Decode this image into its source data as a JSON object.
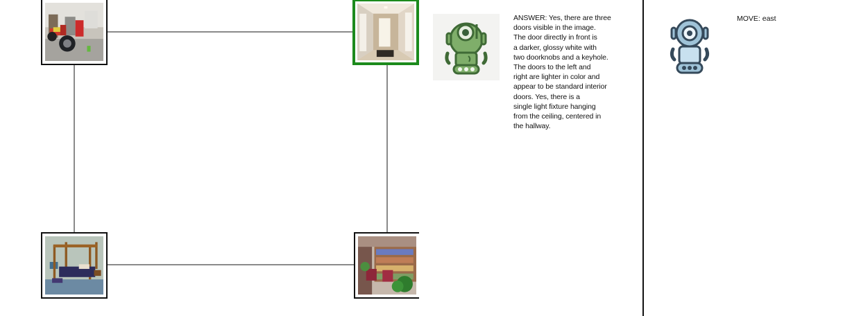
{
  "answer": {
    "text": "ANSWER: Yes, there are three\ndoors visible in the image.\nThe door directly in front is\na darker, glossy white with\ntwo doorknobs and a keyhole.\nThe doors to the left and\nright are lighter in color and\nappear to be standard interior\ndoors.  Yes, there is a\nsingle light fixture hanging\nfrom the ceiling, centered in\nthe hallway."
  },
  "move": {
    "text": "MOVE: east"
  },
  "icons": {
    "answer_avatar": "green-robot-icon",
    "move_avatar": "blue-robot-icon"
  },
  "colors": {
    "current_room_border": "#1c8a1c",
    "edge": "#8a8a8a",
    "divider": "#111111",
    "answer_robot": "#7fae6a",
    "move_robot": "#9fc3d8"
  }
}
